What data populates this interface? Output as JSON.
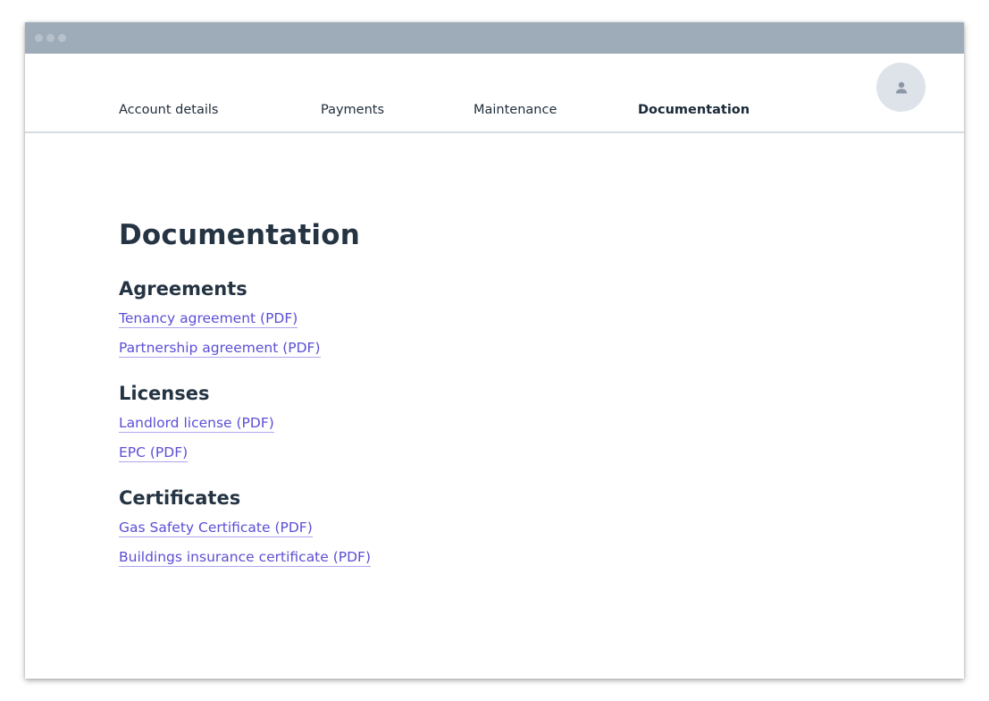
{
  "window": {
    "controls": [
      "dot-1",
      "dot-2",
      "dot-3"
    ]
  },
  "nav": {
    "tabs": [
      {
        "label": "Account details",
        "active": false
      },
      {
        "label": "Payments",
        "active": false
      },
      {
        "label": "Maintenance",
        "active": false
      },
      {
        "label": "Documentation",
        "active": true
      }
    ],
    "avatar_icon": "user-icon"
  },
  "page": {
    "title": "Documentation",
    "sections": [
      {
        "heading": "Agreements",
        "links": [
          "Tenancy agreement (PDF)",
          "Partnership agreement (PDF)"
        ]
      },
      {
        "heading": "Licenses",
        "links": [
          "Landlord license (PDF)",
          "EPC (PDF)"
        ]
      },
      {
        "heading": "Certificates",
        "links": [
          "Gas Safety Certificate (PDF)",
          "Buildings insurance certificate (PDF)"
        ]
      }
    ]
  },
  "colors": {
    "titlebar": "#9eacba",
    "link": "#5b4fd6",
    "heading": "#253443",
    "avatar_bg": "#dde3e9"
  }
}
